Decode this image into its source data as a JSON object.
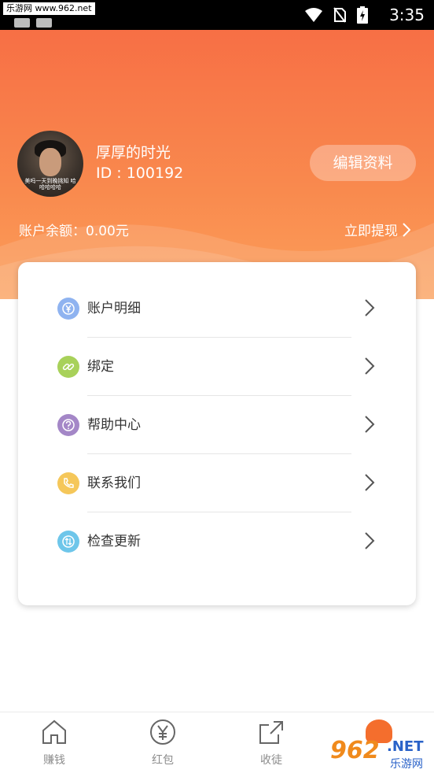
{
  "status_bar": {
    "watermark": "乐游网 www.962.net",
    "time": "3:35"
  },
  "profile": {
    "username": "厚厚的时光",
    "user_id": "ID : 100192",
    "edit_label": "编辑资料",
    "avatar_caption": "美吗一天到晚挑知 哈哈哈哈哈"
  },
  "balance": {
    "text": "账户余额：0.00元",
    "withdraw_label": "立即提现"
  },
  "menu": {
    "items": [
      {
        "label": "账户明细",
        "icon": "yen-icon",
        "color": "#8fb3f0"
      },
      {
        "label": "绑定",
        "icon": "link-icon",
        "color": "#a8d15a"
      },
      {
        "label": "帮助中心",
        "icon": "question-icon",
        "color": "#a487c7"
      },
      {
        "label": "联系我们",
        "icon": "phone-icon",
        "color": "#f5c75a"
      },
      {
        "label": "检查更新",
        "icon": "update-icon",
        "color": "#6ec6ea"
      }
    ]
  },
  "bottom_nav": {
    "items": [
      {
        "label": "赚钱",
        "icon": "home-icon"
      },
      {
        "label": "红包",
        "icon": "yen-circle-icon"
      },
      {
        "label": "收徒",
        "icon": "share-icon"
      }
    ]
  },
  "logo": {
    "main": "962",
    "net": ".NET",
    "sub": "乐游网"
  },
  "colors": {
    "header_top": "#f76f45",
    "header_bottom": "#fb9f5a"
  }
}
